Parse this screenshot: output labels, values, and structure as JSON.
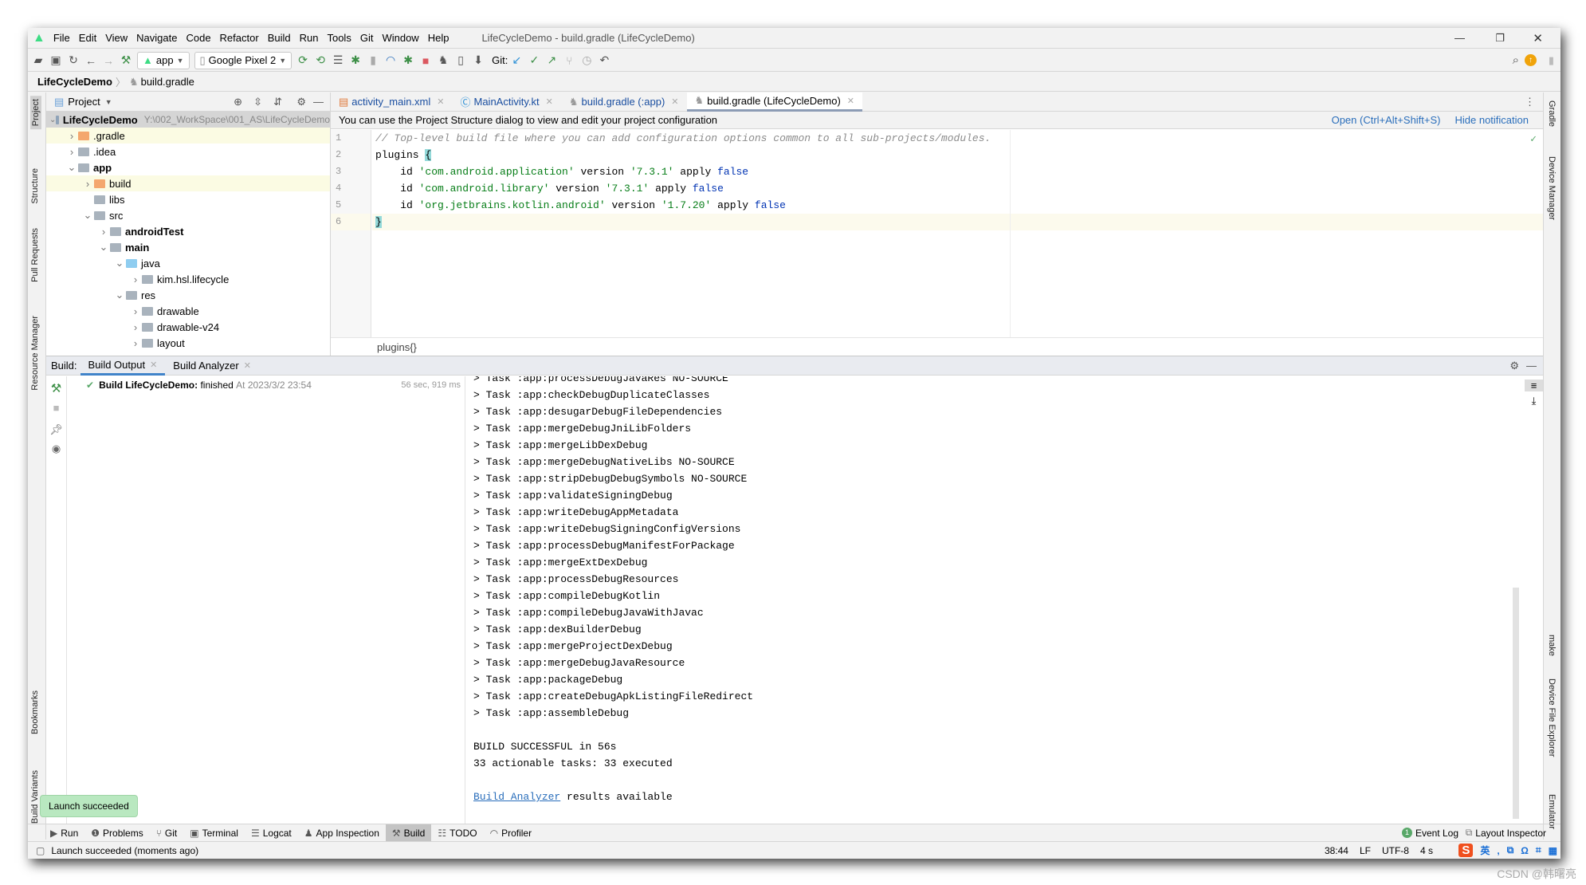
{
  "window": {
    "title": "LifeCycleDemo - build.gradle (LifeCycleDemo)"
  },
  "menu": [
    "File",
    "Edit",
    "View",
    "Navigate",
    "Code",
    "Refactor",
    "Build",
    "Run",
    "Tools",
    "Git",
    "Window",
    "Help"
  ],
  "toolbar": {
    "run_config": "app",
    "device": "Google Pixel 2",
    "git_label": "Git:"
  },
  "breadcrumb": {
    "project": "LifeCycleDemo",
    "file": "build.gradle"
  },
  "project_panel": {
    "title": "Project",
    "root": "LifeCycleDemo",
    "root_path": "Y:\\002_WorkSpace\\001_AS\\LifeCycleDemo",
    "items": [
      {
        "label": ".gradle",
        "depth": 1,
        "arrow": "right",
        "color": "orange",
        "hl": true
      },
      {
        "label": ".idea",
        "depth": 1,
        "arrow": "right"
      },
      {
        "label": "app",
        "depth": 1,
        "arrow": "down",
        "bold": true
      },
      {
        "label": "build",
        "depth": 2,
        "arrow": "right",
        "color": "orange",
        "hl": true
      },
      {
        "label": "libs",
        "depth": 2,
        "arrow": ""
      },
      {
        "label": "src",
        "depth": 2,
        "arrow": "down"
      },
      {
        "label": "androidTest",
        "depth": 3,
        "arrow": "right",
        "bold": true
      },
      {
        "label": "main",
        "depth": 3,
        "arrow": "down",
        "bold": true
      },
      {
        "label": "java",
        "depth": 4,
        "arrow": "down",
        "color": "blue"
      },
      {
        "label": "kim.hsl.lifecycle",
        "depth": 5,
        "arrow": "right"
      },
      {
        "label": "res",
        "depth": 4,
        "arrow": "down"
      },
      {
        "label": "drawable",
        "depth": 5,
        "arrow": "right"
      },
      {
        "label": "drawable-v24",
        "depth": 5,
        "arrow": "right"
      },
      {
        "label": "layout",
        "depth": 5,
        "arrow": "right"
      }
    ]
  },
  "editor": {
    "tabs": [
      {
        "label": "activity_main.xml",
        "active": false
      },
      {
        "label": "MainActivity.kt",
        "active": false
      },
      {
        "label": "build.gradle (:app)",
        "active": false
      },
      {
        "label": "build.gradle (LifeCycleDemo)",
        "active": true
      }
    ],
    "notification": {
      "text": "You can use the Project Structure dialog to view and edit your project configuration",
      "open": "Open (Ctrl+Alt+Shift+S)",
      "hide": "Hide notification"
    },
    "line_numbers": [
      "1",
      "2",
      "3",
      "4",
      "5",
      "6"
    ],
    "lines": {
      "l1": "// Top-level build file where you can add configuration options common to all sub-projects/modules.",
      "l2a": "plugins ",
      "l2b": "{",
      "l3": [
        "    id ",
        "'com.android.application'",
        " version ",
        "'7.3.1'",
        " apply ",
        "false"
      ],
      "l4": [
        "    id ",
        "'com.android.library'",
        " version ",
        "'7.3.1'",
        " apply ",
        "false"
      ],
      "l5": [
        "    id ",
        "'org.jetbrains.kotlin.android'",
        " version ",
        "'1.7.20'",
        " apply ",
        "false"
      ],
      "l6": "}"
    },
    "code_breadcrumb": "plugins{}"
  },
  "build": {
    "label": "Build:",
    "tabs": [
      "Build Output",
      "Build Analyzer"
    ],
    "tree": {
      "title": "Build LifeCycleDemo:",
      "status": "finished",
      "time": "At 2023/3/2 23:54",
      "duration": "56 sec, 919 ms"
    },
    "output": [
      "> Task :app:processDebugJavaRes NO-SOURCE",
      "> Task :app:checkDebugDuplicateClasses",
      "> Task :app:desugarDebugFileDependencies",
      "> Task :app:mergeDebugJniLibFolders",
      "> Task :app:mergeLibDexDebug",
      "> Task :app:mergeDebugNativeLibs NO-SOURCE",
      "> Task :app:stripDebugDebugSymbols NO-SOURCE",
      "> Task :app:validateSigningDebug",
      "> Task :app:writeDebugAppMetadata",
      "> Task :app:writeDebugSigningConfigVersions",
      "> Task :app:processDebugManifestForPackage",
      "> Task :app:mergeExtDexDebug",
      "> Task :app:processDebugResources",
      "> Task :app:compileDebugKotlin",
      "> Task :app:compileDebugJavaWithJavac",
      "> Task :app:dexBuilderDebug",
      "> Task :app:mergeProjectDexDebug",
      "> Task :app:mergeDebugJavaResource",
      "> Task :app:packageDebug",
      "> Task :app:createDebugApkListingFileRedirect",
      "> Task :app:assembleDebug",
      "",
      "BUILD SUCCESSFUL in 56s",
      "33 actionable tasks: 33 executed",
      ""
    ],
    "analyzer_link": "Build Analyzer",
    "analyzer_rest": " results available"
  },
  "left_stripe": [
    "Project",
    "Structure",
    "Pull Requests",
    "Resource Manager",
    "Bookmarks",
    "Build Variants"
  ],
  "right_stripe": [
    "Gradle",
    "Device Manager",
    "make",
    "Device File Explorer",
    "Emulator"
  ],
  "tool_windows": [
    "Run",
    "Problems",
    "Git",
    "Terminal",
    "Logcat",
    "App Inspection",
    "Build",
    "TODO",
    "Profiler"
  ],
  "tool_windows_right": {
    "event_log": "Event Log",
    "event_count": "1",
    "layout_inspector": "Layout Inspector"
  },
  "balloon": "Launch succeeded",
  "status": {
    "message": "Launch succeeded (moments ago)",
    "position": "38:44",
    "line_sep": "LF",
    "encoding": "UTF-8",
    "indent": "4 s",
    "ime": "英"
  },
  "watermark": "CSDN @韩曙亮",
  "colors": {
    "string": "#067d17",
    "keyword": "#0033b3",
    "link": "#2a6ebb",
    "success": "#59a869"
  }
}
